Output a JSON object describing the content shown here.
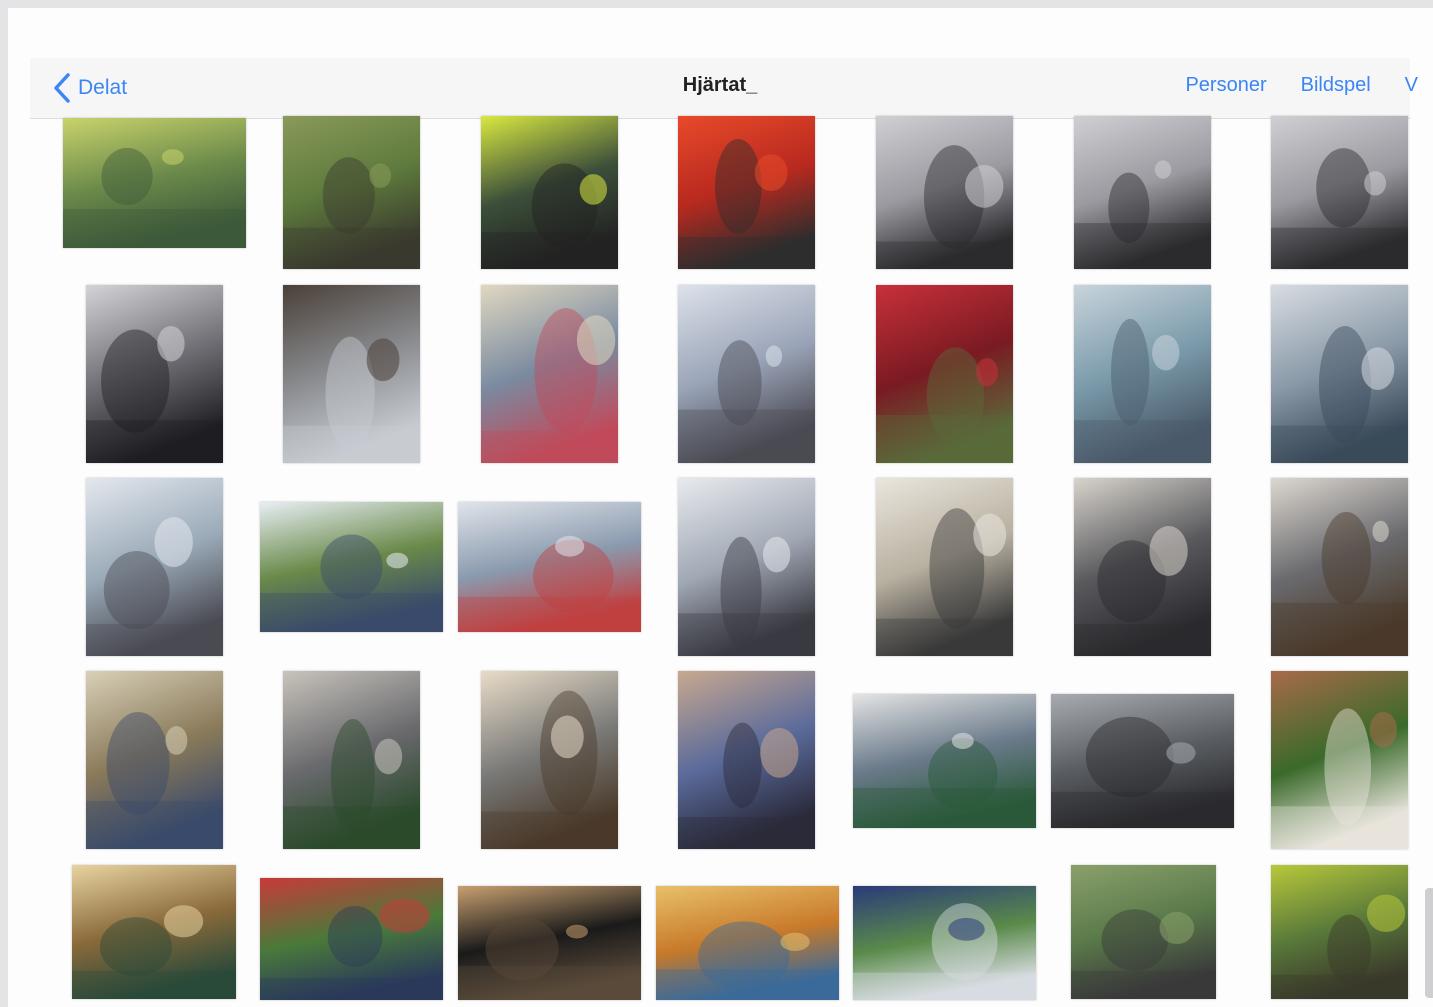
{
  "nav": {
    "back_label": "Delat",
    "title": "Hjärtat_",
    "actions": [
      "Personer",
      "Bildspel",
      "V"
    ]
  },
  "colors": {
    "accent": "#3b86f4",
    "screen_bg": "#fdfdfd",
    "nav_bg": "#f6f6f7"
  },
  "icons": {
    "back": "chevron-left-icon"
  },
  "photos": [
    {
      "subject": "child-cycling-in-field"
    },
    {
      "subject": "grass-lawn-path"
    },
    {
      "subject": "paramedic-in-yellow-vest"
    },
    {
      "subject": "rescue-crew-red-jackets"
    },
    {
      "subject": "helicopter-sky-window-1"
    },
    {
      "subject": "helicopter-sky-window-2"
    },
    {
      "subject": "helicopter-sky-window-3"
    },
    {
      "subject": "helicopter-cloudy-sky"
    },
    {
      "subject": "hospital-tower-building"
    },
    {
      "subject": "patient-bed-colorful-blanket"
    },
    {
      "subject": "patient-holding-card"
    },
    {
      "subject": "red-roses-bouquet"
    },
    {
      "subject": "hospital-ward-bed"
    },
    {
      "subject": "visitor-at-bedside"
    },
    {
      "subject": "patient-in-icu"
    },
    {
      "subject": "hospital-aerial-view"
    },
    {
      "subject": "family-selfie-in-ward"
    },
    {
      "subject": "patients-in-bed"
    },
    {
      "subject": "man-at-table"
    },
    {
      "subject": "two-people-in-robes-stairs"
    },
    {
      "subject": "robes-on-staircase"
    },
    {
      "subject": "hospital-corridor"
    },
    {
      "subject": "group-standing-indoors"
    },
    {
      "subject": "man-at-dinner-table"
    },
    {
      "subject": "pills-in-hand"
    },
    {
      "subject": "car-selfie-three-people"
    },
    {
      "subject": "toll-gate-road"
    },
    {
      "subject": "man-sitting-in-garden"
    },
    {
      "subject": "hotel-room-doorway"
    },
    {
      "subject": "couple-in-park"
    },
    {
      "subject": "car-at-night"
    },
    {
      "subject": "autumn-selfie-couple"
    },
    {
      "subject": "group-outdoors-suits"
    },
    {
      "subject": "person-in-green-field"
    },
    {
      "subject": "cyclist-on-path"
    }
  ]
}
